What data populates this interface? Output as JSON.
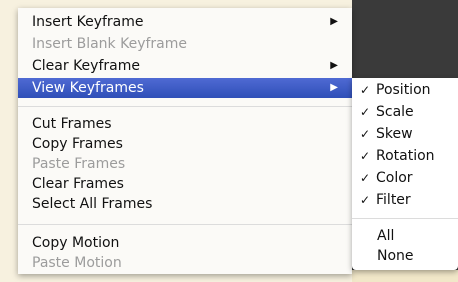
{
  "main_menu": {
    "items": [
      {
        "label": "Insert Keyframe",
        "submenu": true
      },
      {
        "label": "Insert Blank Keyframe",
        "disabled": true
      },
      {
        "label": "Clear Keyframe",
        "submenu": true
      },
      {
        "label": "View Keyframes",
        "submenu": true,
        "selected": true
      },
      {
        "label": "Cut Frames"
      },
      {
        "label": "Copy Frames"
      },
      {
        "label": "Paste Frames",
        "disabled": true
      },
      {
        "label": "Clear Frames"
      },
      {
        "label": "Select All Frames"
      },
      {
        "label": "Copy Motion"
      },
      {
        "label": "Paste Motion",
        "disabled": true
      }
    ],
    "arrow_glyph": "▶"
  },
  "sub_menu": {
    "check_glyph": "✓",
    "items": [
      {
        "label": "Position",
        "checked": true
      },
      {
        "label": "Scale",
        "checked": true
      },
      {
        "label": "Skew",
        "checked": true
      },
      {
        "label": "Rotation",
        "checked": true
      },
      {
        "label": "Color",
        "checked": true
      },
      {
        "label": "Filter",
        "checked": true
      },
      {
        "label": "All",
        "checked": false
      },
      {
        "label": "None",
        "checked": false
      }
    ]
  },
  "colors": {
    "selection": "#3a5bc7",
    "disabled_text": "#9c9c9c",
    "backdrop": "#3a3a3a"
  }
}
